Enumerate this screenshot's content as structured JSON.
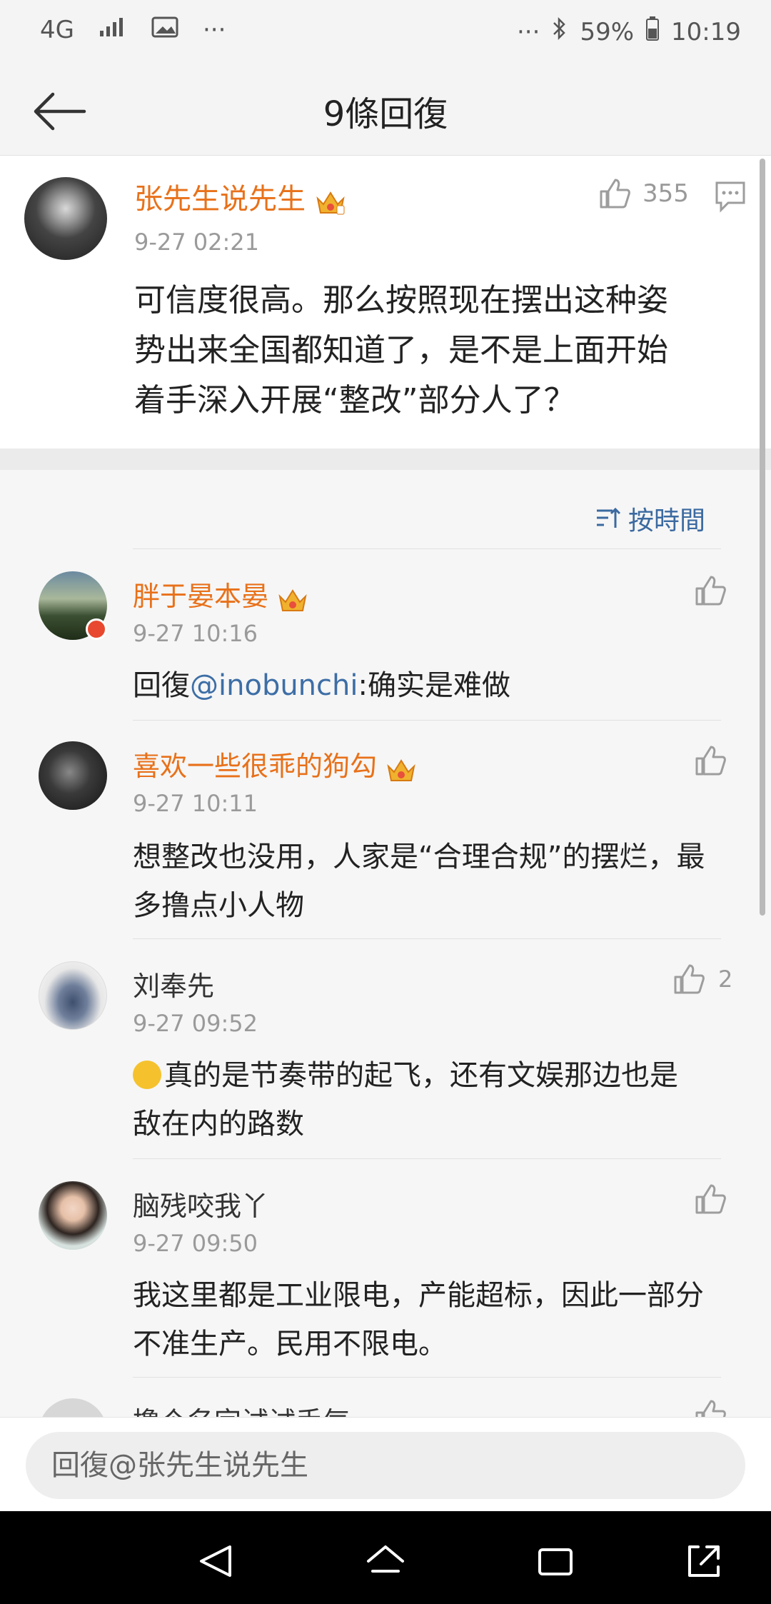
{
  "status": {
    "network": "4G",
    "battery_percent": "59%",
    "time": "10:19",
    "more_left": "···",
    "more_right": "···"
  },
  "nav": {
    "title": "9條回復"
  },
  "main_comment": {
    "author": "张先生说先生",
    "time": "9-27 02:21",
    "likes": "355",
    "text_line1": "可信度很高。那么按照现在摆出这种姿",
    "text_line2": "势出来全国都知道了，是不是上面开始",
    "text_line3": "着手深入开展“整改”部分人了？"
  },
  "sort_label": "按時間",
  "replies": [
    {
      "author": "胖于晏本晏",
      "time": "9-27 10:16",
      "reply_prefix": "回復",
      "mention": "@inobunchi",
      "text": ":确实是难做",
      "likes": ""
    },
    {
      "author": "喜欢一些很乖的狗勾",
      "time": "9-27 10:11",
      "line1": "想整改也没用，人家是“合理合规”的摆烂，最",
      "line2": "多撸点小人物",
      "likes": ""
    },
    {
      "author": "刘奉先",
      "time": "9-27 09:52",
      "line1": "真的是节奏带的起飞，还有文娱那边也是",
      "line2": "敌在内的路数",
      "likes": "2"
    },
    {
      "author": "脑残咬我丫",
      "time": "9-27 09:50",
      "line1": "我这里都是工业限电，产能超标，因此一部分",
      "line2": "不准生产。民用不限电。",
      "likes": ""
    },
    {
      "author": "撸个名字试试手气",
      "time": "",
      "likes": ""
    }
  ],
  "bottom": {
    "placeholder": "回復@张先生说先生"
  },
  "colors": {
    "username": "#e8711a",
    "mention": "#3d6ea6",
    "sort": "#3b6aa0"
  }
}
